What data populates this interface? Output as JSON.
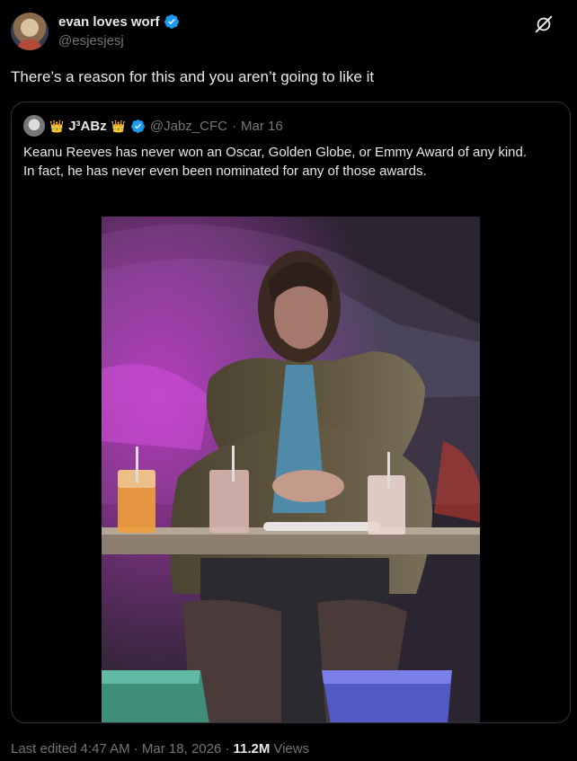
{
  "tweet": {
    "display_name": "evan loves worf",
    "handle": "@esjesjesj",
    "text": "There’s a reason for this and you aren’t going to like it"
  },
  "quote": {
    "name_prefix": "J³ABz",
    "handle": "@Jabz_CFC",
    "separator": "·",
    "date": "Mar 16",
    "text_line1": "Keanu Reeves has never won an Oscar, Golden Globe, or Emmy Award of any kind.",
    "text_line2": "In fact, he has never even been nominated for any of those awards."
  },
  "footer": {
    "edited": "Last edited 4:47 AM · Mar 18, 2026 ·",
    "views_count": "11.2M",
    "views_label": "Views"
  },
  "colors": {
    "background": "#000000",
    "text": "#e7e9ea",
    "muted": "#71767b",
    "border": "#2f3336",
    "verified": "#1d9bf0"
  }
}
